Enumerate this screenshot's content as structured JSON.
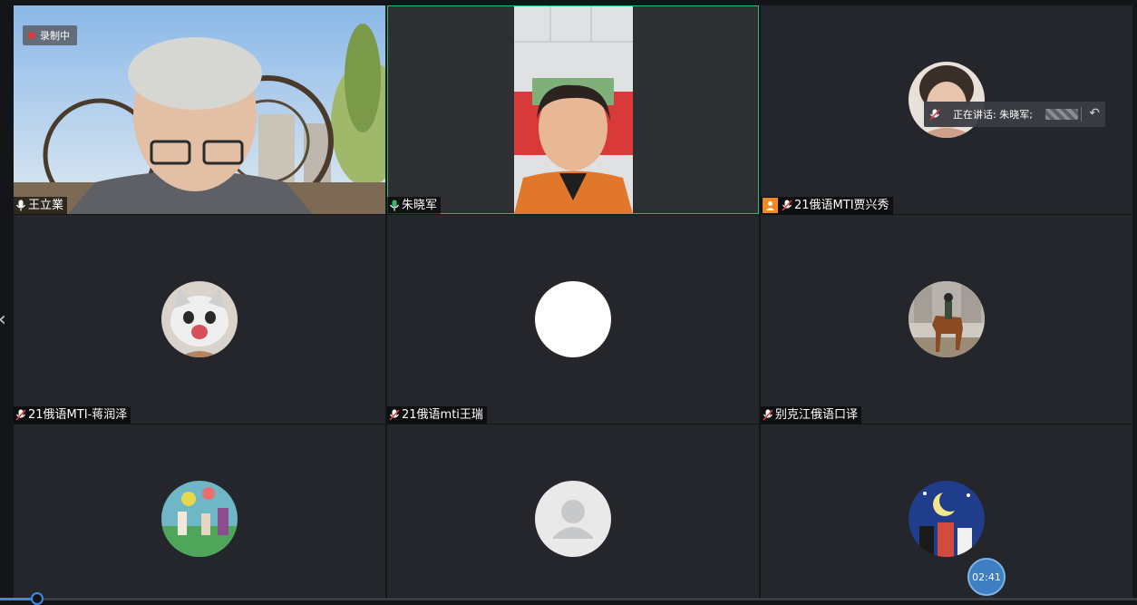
{
  "recording_label": "录制中",
  "speaking_prefix": "正在讲话: 朱晓军;",
  "timer": "02:41",
  "playback_progress": 0.03,
  "participants": [
    {
      "name": "王立業",
      "mic": "mic-on-icon",
      "kind": "video"
    },
    {
      "name": "朱晓军",
      "mic": "mic-speaking-icon",
      "kind": "video"
    },
    {
      "name": "21俄语MTI贾兴秀",
      "mic": "mic-muted-icon",
      "kind": "avatar",
      "host_badge": "host-person-icon"
    },
    {
      "name": "21俄语MTI-蒋润泽",
      "mic": "mic-muted-icon",
      "kind": "avatar"
    },
    {
      "name": "21俄语mti王瑞",
      "mic": "mic-muted-icon",
      "kind": "avatar"
    },
    {
      "name": "别克江俄语口译",
      "mic": "mic-muted-icon",
      "kind": "avatar"
    },
    {
      "name": "",
      "mic": "",
      "kind": "avatar"
    },
    {
      "name": "",
      "mic": "",
      "kind": "avatar"
    },
    {
      "name": "",
      "mic": "",
      "kind": "avatar"
    }
  ],
  "colors": {
    "speaking_green": "#2fbf6b",
    "muted_red": "#e04040",
    "accent_blue": "#3d8be0",
    "tile_bg": "#24262b"
  }
}
